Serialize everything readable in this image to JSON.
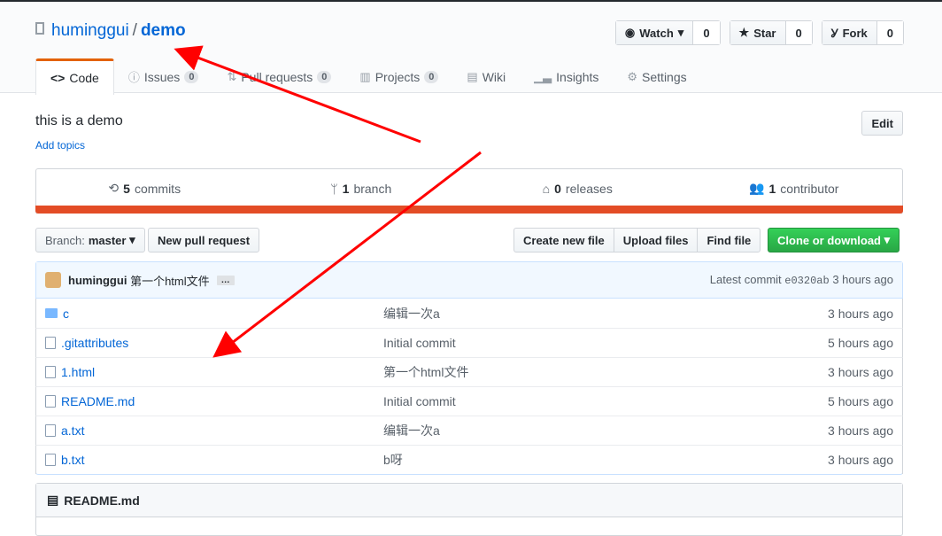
{
  "repo": {
    "owner": "huminggui",
    "name": "demo"
  },
  "actions": [
    {
      "label": "Watch",
      "count": "0",
      "icon": "eye-icon"
    },
    {
      "label": "Star",
      "count": "0",
      "icon": "star-icon"
    },
    {
      "label": "Fork",
      "count": "0",
      "icon": "fork-icon"
    }
  ],
  "tabs": [
    {
      "label": "Code",
      "icon": "code-icon"
    },
    {
      "label": "Issues",
      "count": "0"
    },
    {
      "label": "Pull requests",
      "count": "0"
    },
    {
      "label": "Projects",
      "count": "0"
    },
    {
      "label": "Wiki"
    },
    {
      "label": "Insights"
    },
    {
      "label": "Settings"
    }
  ],
  "description": "this is a demo",
  "add_topics": "Add topics",
  "edit_label": "Edit",
  "stats": [
    {
      "num": "5",
      "label": "commits"
    },
    {
      "num": "1",
      "label": "branch"
    },
    {
      "num": "0",
      "label": "releases"
    },
    {
      "num": "1",
      "label": "contributor"
    }
  ],
  "language_color": "#e34c26",
  "toolbar": {
    "branch_label": "Branch:",
    "branch": "master",
    "new_pr": "New pull request",
    "create": "Create new file",
    "upload": "Upload files",
    "find": "Find file",
    "clone": "Clone or download"
  },
  "latest_commit": {
    "author": "huminggui",
    "message": "第一个html文件",
    "dots": "…",
    "prefix": "Latest commit",
    "sha": "e0320ab",
    "age": "3 hours ago"
  },
  "files": [
    {
      "name": "c",
      "type": "dir",
      "message": "编辑一次a",
      "age": "3 hours ago"
    },
    {
      "name": ".gitattributes",
      "type": "file",
      "message": "Initial commit",
      "age": "5 hours ago"
    },
    {
      "name": "1.html",
      "type": "file",
      "message": "第一个html文件",
      "age": "3 hours ago"
    },
    {
      "name": "README.md",
      "type": "file",
      "message": "Initial commit",
      "age": "5 hours ago"
    },
    {
      "name": "a.txt",
      "type": "file",
      "message": "编辑一次a",
      "age": "3 hours ago"
    },
    {
      "name": "b.txt",
      "type": "file",
      "message": "b呀",
      "age": "3 hours ago"
    }
  ],
  "readme_title": "README.md"
}
